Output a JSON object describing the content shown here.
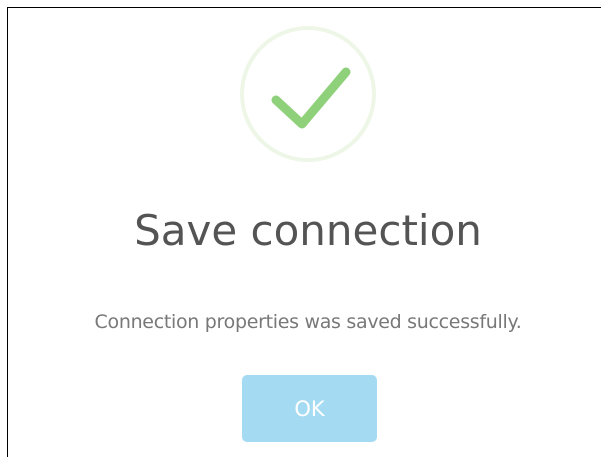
{
  "dialog": {
    "title": "Save connection",
    "message": "Connection properties was saved successfully.",
    "ok_label": "OK",
    "icon": "checkmark-icon"
  },
  "colors": {
    "accent": "#a5dbf2",
    "success": "#8fd17a",
    "success_ring": "#eef7e7",
    "title": "#545454",
    "message": "#787878"
  }
}
